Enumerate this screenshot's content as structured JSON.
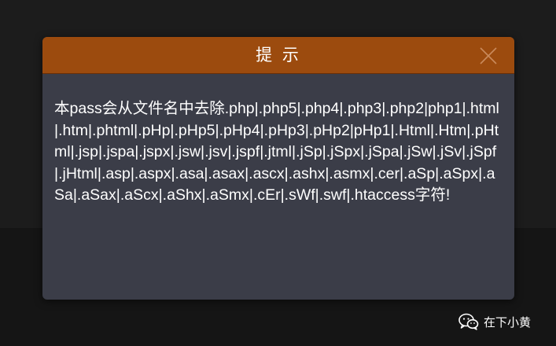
{
  "dialog": {
    "title": "提 示",
    "message": "本pass会从文件名中去除.php|.php5|.php4|.php3|.php2|php1|.html|.htm|.phtml|.pHp|.pHp5|.pHp4|.pHp3|.pHp2|pHp1|.Html|.Htm|.pHtml|.jsp|.jspa|.jspx|.jsw|.jsv|.jspf|.jtml|.jSp|.jSpx|.jSpa|.jSw|.jSv|.jSpf|.jHtml|.asp|.aspx|.asa|.asax|.ascx|.ashx|.asmx|.cer|.aSp|.aSpx|.aSa|.aSax|.aScx|.aShx|.aSmx|.cEr|.sWf|.swf|.htaccess字符!",
    "close_icon": "close-icon"
  },
  "watermark": {
    "icon": "wechat-icon",
    "text": "在下小黄"
  },
  "colors": {
    "page_background": "#1c1c1c",
    "header_background": "#9c4b0e",
    "body_background": "#3b3d48",
    "text": "#ffffff"
  }
}
